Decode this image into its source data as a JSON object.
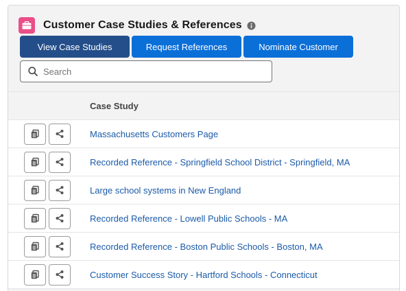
{
  "header": {
    "title": "Customer Case Studies & References",
    "icon": "briefcase-icon",
    "info_icon": "info-icon",
    "accent_color": "#ea4f87"
  },
  "buttons": [
    {
      "label": "View Case Studies",
      "active": true
    },
    {
      "label": "Request References",
      "active": false
    },
    {
      "label": "Nominate Customer",
      "active": false
    }
  ],
  "search": {
    "placeholder": "Search",
    "value": ""
  },
  "table": {
    "column_header": "Case Study",
    "row_action_icons": [
      "copy-icon",
      "share-icon"
    ],
    "rows": [
      "Massachusetts Customers Page",
      "Recorded Reference - Springfield School District - Springfield, MA",
      "Large school systems in New England",
      "Recorded Reference - Lowell Public Schools - MA",
      "Recorded Reference - Boston Public Schools - Boston, MA",
      "Customer Success Story - Hartford Schools - Connecticut"
    ]
  },
  "colors": {
    "active_button": "#244e8a",
    "button": "#0b6fd8",
    "link": "#1a5aa8"
  }
}
